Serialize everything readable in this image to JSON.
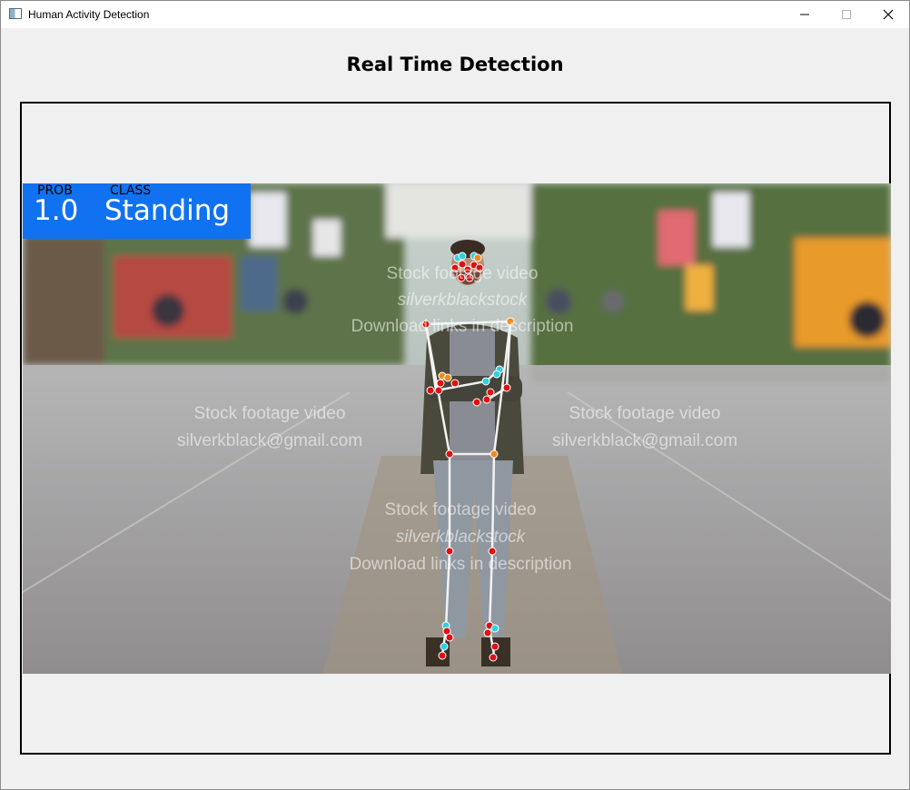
{
  "window": {
    "title": "Human Activity Detection",
    "controls": {
      "minimize": "—",
      "maximize": "☐",
      "close": "✕"
    }
  },
  "page": {
    "heading": "Real Time Detection"
  },
  "detection": {
    "prob_label": "PROB",
    "class_label": "CLASS",
    "prob_value": "1.0",
    "class_value": "Standing",
    "badge_color": "#1072f0"
  },
  "watermarks": {
    "stock_line": "Stock footage video",
    "brand_line": "silverkblackstock",
    "email_line": "silverkblack@gmail.com",
    "download_line": "Download links in description"
  },
  "colors": {
    "skeleton_line": "#f2f2f2",
    "landmark_red": "#e01010",
    "landmark_orange": "#f08a20",
    "landmark_cyan": "#30d0e0"
  }
}
